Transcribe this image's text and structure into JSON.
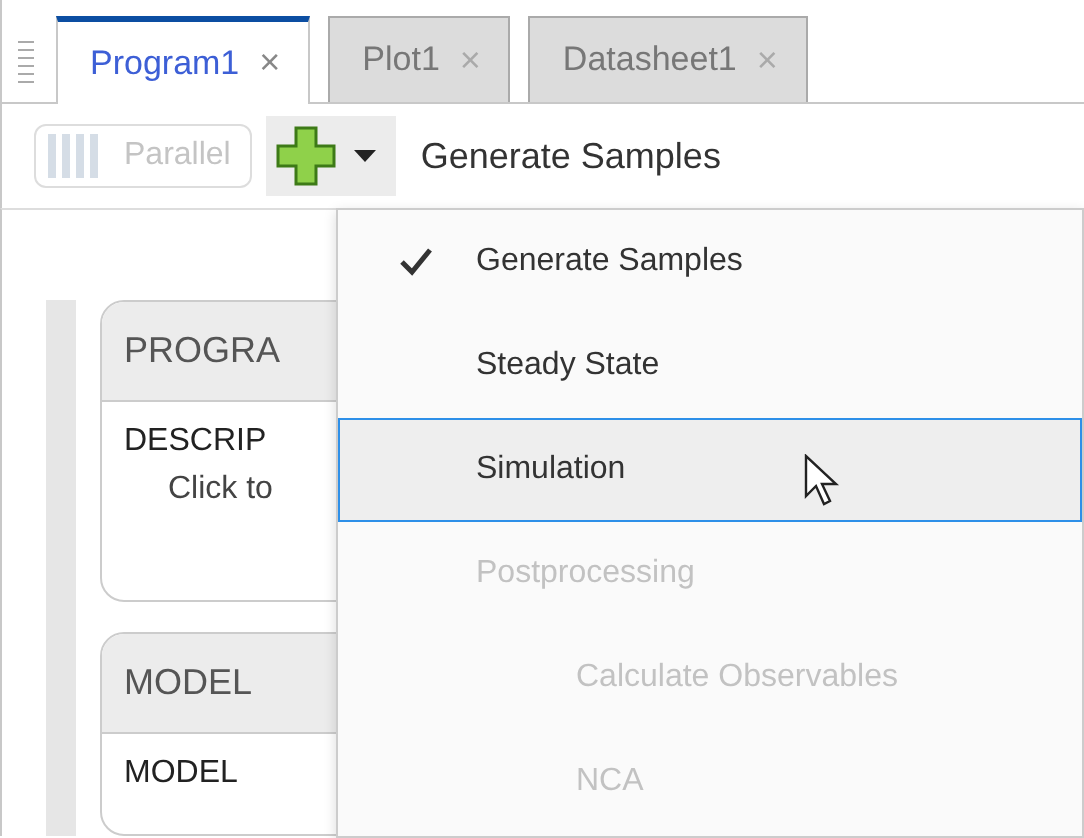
{
  "tabs": [
    {
      "label": "Program1",
      "close": "×",
      "selected": true
    },
    {
      "label": "Plot1",
      "close": "×",
      "selected": false
    },
    {
      "label": "Datasheet1",
      "close": "×",
      "selected": false
    }
  ],
  "toolbar": {
    "parallel_button": {
      "label": "Parallel",
      "disabled": true
    },
    "step_label": "Generate Samples"
  },
  "program": {
    "cards": [
      {
        "header": "PROGRA",
        "lines": [
          {
            "kind": "title",
            "text": "DESCRIP"
          },
          {
            "kind": "hint",
            "text": "Click to"
          }
        ]
      },
      {
        "header": "MODEL",
        "lines": [
          {
            "kind": "title",
            "text": "MODEL"
          }
        ]
      }
    ]
  },
  "menu": {
    "items": [
      {
        "label": "Generate Samples",
        "checked": true,
        "disabled": false,
        "highlighted": false
      },
      {
        "label": "Steady State",
        "checked": false,
        "disabled": false,
        "highlighted": false
      },
      {
        "label": "Simulation",
        "checked": false,
        "disabled": false,
        "highlighted": true
      },
      {
        "label": "Postprocessing",
        "checked": false,
        "disabled": true,
        "highlighted": false,
        "children": [
          {
            "label": "Calculate Observables",
            "checked": false,
            "disabled": true,
            "highlighted": false
          },
          {
            "label": "NCA",
            "checked": false,
            "disabled": true,
            "highlighted": false
          }
        ]
      }
    ]
  }
}
